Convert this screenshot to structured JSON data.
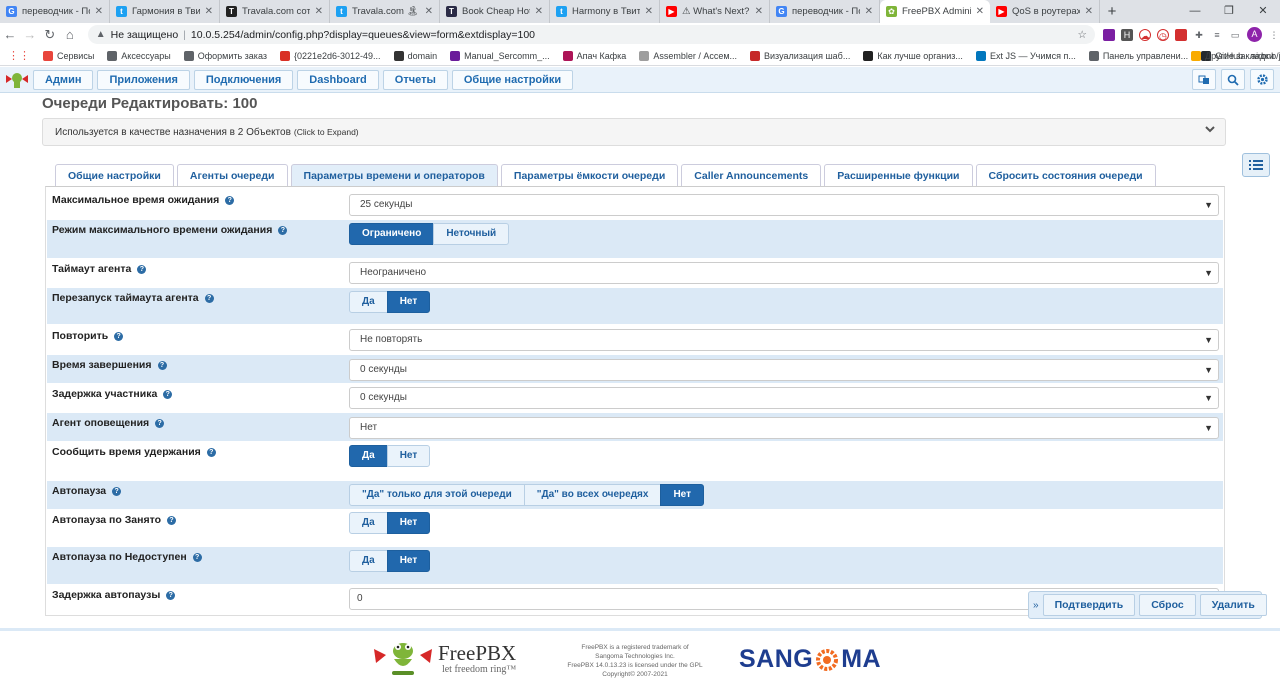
{
  "browser": {
    "tabs": [
      {
        "title": "переводчик - Поиск",
        "icon": "google-icon",
        "color": "#4285f4",
        "glyph": "G"
      },
      {
        "title": "Гармония в Твиттере",
        "icon": "twitter-icon",
        "color": "#1da1f2",
        "glyph": "t"
      },
      {
        "title": "Travala.com сотрудн",
        "icon": "travala-icon",
        "color": "#222222",
        "glyph": "T"
      },
      {
        "title": "Travala.com 🏝 🏛",
        "icon": "twitter-icon",
        "color": "#1da1f2",
        "glyph": "t"
      },
      {
        "title": "Book Cheap Hotels",
        "icon": "travala-icon",
        "color": "#2b2b46",
        "glyph": "T"
      },
      {
        "title": "Harmony в Твиттер",
        "icon": "twitter-icon",
        "color": "#1da1f2",
        "glyph": "t"
      },
      {
        "title": "⚠ What's Next? ⚠ ⚡",
        "icon": "youtube-icon",
        "color": "#ff0000",
        "glyph": "▶"
      },
      {
        "title": "переводчик - Поиск",
        "icon": "google-icon",
        "color": "#4285f4",
        "glyph": "G"
      },
      {
        "title": "FreePBX Administra",
        "icon": "freepbx-icon",
        "color": "#7fb539",
        "glyph": "✿"
      },
      {
        "title": "QoS в роутерах Mi",
        "icon": "youtube-icon",
        "color": "#ff0000",
        "glyph": "▶"
      }
    ],
    "active_tab": 8,
    "insecure_label": "Не защищено",
    "url": "10.0.5.254/admin/config.php?display=queues&view=form&extdisplay=100",
    "bookmarks": [
      {
        "label": "Сервисы",
        "color": "#e8453c"
      },
      {
        "label": "Аксессуары",
        "color": "#5f6368"
      },
      {
        "label": "Оформить заказ",
        "color": "#5f6368"
      },
      {
        "label": "{0221e2d6-3012-49...",
        "color": "#d93025"
      },
      {
        "label": "domain",
        "color": "#333333"
      },
      {
        "label": "Manual_Sercomm_...",
        "color": "#6a1b9a"
      },
      {
        "label": "Апач Кафка",
        "color": "#ad1457"
      },
      {
        "label": "Assembler / Ассем...",
        "color": "#9e9e9e"
      },
      {
        "label": "Визуализация шаб...",
        "color": "#c62828"
      },
      {
        "label": "Как лучше организ...",
        "color": "#212121"
      },
      {
        "label": "Ext JS — Учимся п...",
        "color": "#0277bd"
      },
      {
        "label": "Панель управлени...",
        "color": "#5f6368"
      },
      {
        "label": "GitHub - airbnb/jav...",
        "color": "#24292e"
      }
    ],
    "other_bookmarks": "Другие закладки",
    "avatar_letter": "A"
  },
  "nav": {
    "items": [
      "Админ",
      "Приложения",
      "Подключения",
      "Dashboard",
      "Отчеты",
      "Общие настройки"
    ]
  },
  "page": {
    "title": "Очереди Редактировать: 100",
    "used_as": "Используется в качестве назначения в 2 Объектов",
    "used_as_hint": "(Click to Expand)"
  },
  "tabs": [
    "Общие настройки",
    "Агенты очереди",
    "Параметры времени и операторов",
    "Параметры ёмкости очереди",
    "Caller Announcements",
    "Расширенные функции",
    "Сбросить состояния очереди"
  ],
  "active_tab_index": 2,
  "fields": {
    "max_wait": {
      "label": "Максимальное время ожидания",
      "value": "25 секунды"
    },
    "max_wait_mode": {
      "label": "Режим максимального времени ожидания",
      "options": [
        "Ограничено",
        "Неточный"
      ],
      "selected": 0
    },
    "agent_timeout": {
      "label": "Таймаут агента",
      "value": "Неограничено"
    },
    "agent_timeout_restart": {
      "label": "Перезапуск таймаута агента",
      "options": [
        "Да",
        "Нет"
      ],
      "selected": 1
    },
    "retry": {
      "label": "Повторить",
      "value": "Не повторять"
    },
    "wrapup": {
      "label": "Время завершения",
      "value": "0 секунды"
    },
    "member_delay": {
      "label": "Задержка участника",
      "value": "0 секунды"
    },
    "agent_announce": {
      "label": "Агент оповещения",
      "value": "Нет"
    },
    "report_hold": {
      "label": "Сообщить время удержания",
      "options": [
        "Да",
        "Нет"
      ],
      "selected": 0
    },
    "autopause": {
      "label": "Автопауза",
      "options": [
        "\"Да\" только для этой очереди",
        "\"Да\" во всех очередях",
        "Нет"
      ],
      "selected": 2
    },
    "autopause_busy": {
      "label": "Автопауза по Занято",
      "options": [
        "Да",
        "Нет"
      ],
      "selected": 1
    },
    "autopause_unavail": {
      "label": "Автопауза по Недоступен",
      "options": [
        "Да",
        "Нет"
      ],
      "selected": 1
    },
    "autopause_delay": {
      "label": "Задержка автопаузы",
      "value": "0"
    }
  },
  "actions": {
    "submit": "Подтвердить",
    "reset": "Сброс",
    "delete": "Удалить"
  },
  "footer": {
    "brand": "FreePBX",
    "tagline": "let freedom ring™",
    "legal_lines": [
      "FreePBX is a registered trademark of",
      "Sangoma Technologies Inc.",
      "FreePBX 14.0.13.23 is licensed under the GPL",
      "Copyright© 2007-2021"
    ],
    "sangoma_pre": "SANG",
    "sangoma_post": "MA"
  },
  "colors": {
    "accent": "#2168ad",
    "row_shade": "#dbe9f6",
    "nav_bg": "#e9f2fa"
  }
}
